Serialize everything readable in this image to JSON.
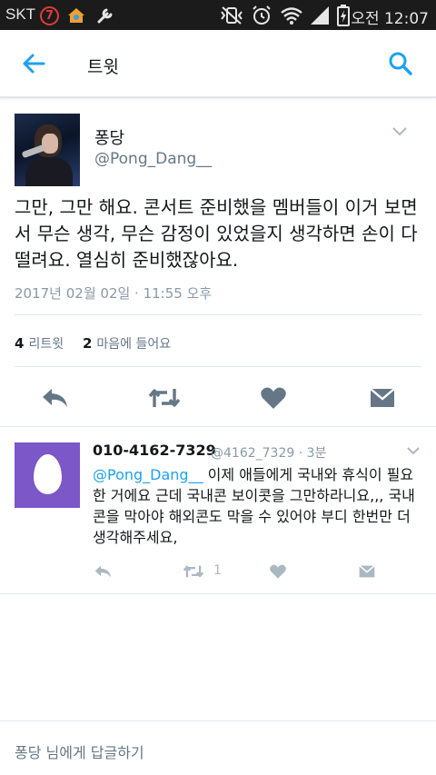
{
  "status_bar": {
    "carrier": "SKT",
    "notification_count": "7",
    "time": "오전 12:07"
  },
  "app_bar": {
    "title": "트윗"
  },
  "tweet": {
    "display_name": "퐁당",
    "handle": "@Pong_Dang__",
    "text": "그만, 그만 해요. 콘서트 준비했을 멤버들이 이거 보면서 무슨 생각, 무슨 감정이 있었을지 생각하면 손이 다 떨려요. 열심히 준비했잖아요.",
    "timestamp": "2017년 02월 02일 · 11:55 오후",
    "retweet_count": "4",
    "retweet_label": "리트윗",
    "like_count": "2",
    "like_label": "마음에 들어요"
  },
  "reply": {
    "display_name": "010-4162-7329",
    "meta": "@4162_7329 · 3분",
    "mention": "@Pong_Dang__",
    "text": " 이제 애들에게 국내와 휴식이 필요한 거에요 근데 국내콘 보이콧을 그만하라니요,,, 국내콘을 막아야 해외콘도 막을 수 있어야 부디 한번만 더 생각해주세요,",
    "retweet_count": "1"
  },
  "compose": {
    "placeholder": "퐁당 님에게 답글하기"
  },
  "colors": {
    "accent": "#1da1f2",
    "icon_gray": "#657786",
    "icon_light": "#aab8c2",
    "egg_bg": "#7b57c8"
  },
  "icons": [
    "back-arrow-icon",
    "search-icon",
    "chevron-down-icon",
    "reply-icon",
    "retweet-icon",
    "heart-icon",
    "message-icon"
  ]
}
